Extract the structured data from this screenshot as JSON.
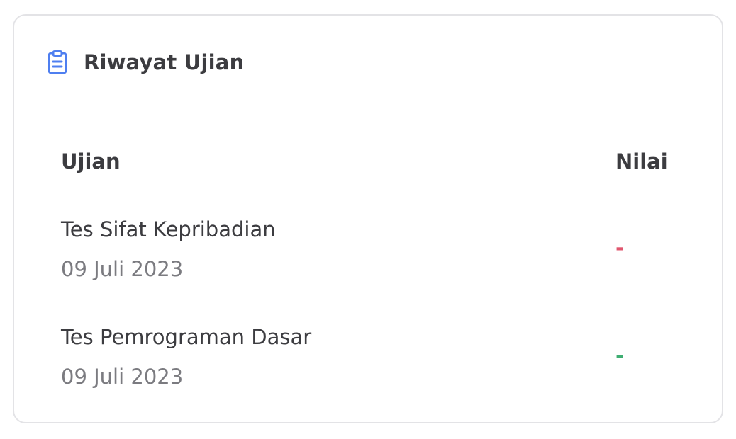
{
  "card": {
    "title": "Riwayat Ujian",
    "icon": "clipboard-icon",
    "icon_color": "#4f7ff0"
  },
  "table": {
    "columns": {
      "exam": "Ujian",
      "score": "Nilai"
    },
    "rows": [
      {
        "name": "Tes Sifat Kepribadian",
        "date": "09 Juli 2023",
        "score": "-",
        "score_color": "#e0566e"
      },
      {
        "name": "Tes Pemrograman Dasar",
        "date": "09 Juli 2023",
        "score": "-",
        "score_color": "#3fae72"
      }
    ]
  }
}
